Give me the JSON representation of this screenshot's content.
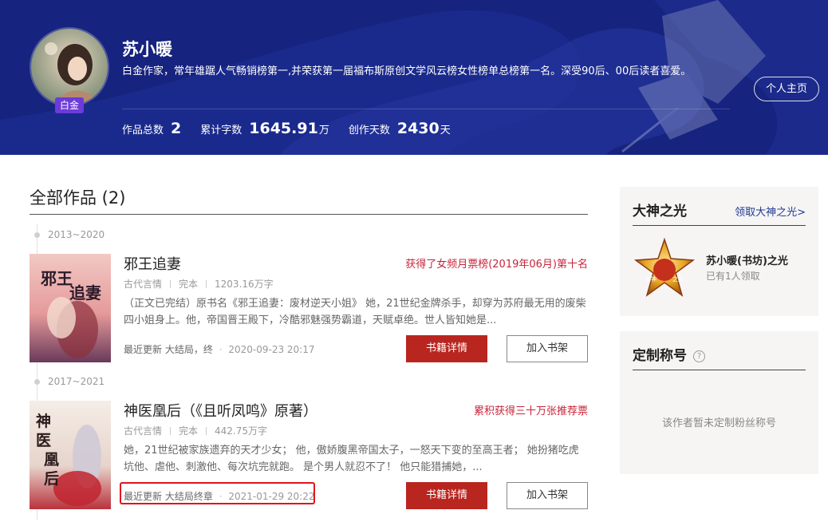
{
  "author": {
    "name": "苏小暖",
    "badge": "白金",
    "intro": "白金作家，常年雄踞人气畅销榜第一,并荣获第一届福布斯原创文学风云榜女性榜单总榜第一名。深受90后、00后读者喜爱。",
    "home_button": "个人主页",
    "stats": {
      "works_label": "作品总数",
      "works_value": "2",
      "words_label": "累计字数",
      "words_value": "1645.91",
      "words_unit": "万",
      "days_label": "创作天数",
      "days_value": "2430",
      "days_unit": "天"
    }
  },
  "works": {
    "title": "全部作品 (2)",
    "books": [
      {
        "year_range": "2013~2020",
        "title": "邪王追妻",
        "honor": "获得了女频月票榜(2019年06月)第十名",
        "category": "古代言情",
        "status": "完本",
        "word_count": "1203.16万字",
        "description": "（正文已完结）原书名《邪王追妻：废材逆天小姐》 她，21世纪金牌杀手，却穿为苏府最无用的废柴四小姐身上。他，帝国晋王殿下，冷酷邪魅强势霸道，天赋卓绝。世人皆知她是...",
        "update_label": "最近更新",
        "update_chapter": "大结局，终",
        "update_time": "2020-09-23 20:17",
        "detail_button": "书籍详情",
        "shelf_button": "加入书架",
        "cover_text": "邪王追妻"
      },
      {
        "year_range": "2017~2021",
        "title": "神医凰后（《且听凤鸣》原著）",
        "honor": "累积获得三十万张推荐票",
        "category": "古代言情",
        "status": "完本",
        "word_count": "442.75万字",
        "description": "她，21世纪被家族遗弃的天才少女； 他，傲娇腹黑帝国太子，一怒天下变的至高王者； 她扮猪吃虎坑他、虐他、刺激他、每次坑完就跑。 是个男人就忍不了！ 他只能猎捕她，...",
        "update_label": "最近更新",
        "update_chapter": "大结局终章",
        "update_time": "2021-01-29 20:22",
        "detail_button": "书籍详情",
        "shelf_button": "加入书架",
        "cover_text": "神医凰后"
      }
    ]
  },
  "sidebar": {
    "glory": {
      "title": "大神之光",
      "link": "领取大神之光>",
      "medal_name": "苏小暖(书坊)之光",
      "medal_sub": "已有1人领取",
      "medal_text_left": "大神",
      "medal_text_right": "之光"
    },
    "custom_title": {
      "title": "定制称号",
      "help": "?",
      "empty": "该作者暂未定制粉丝称号"
    }
  },
  "colors": {
    "banner_bg": "#16237f",
    "badge": "#6c3bd9",
    "honor_red": "#c8243a",
    "button_red": "#b8261f",
    "link_blue": "#1f3a93",
    "highlight_red": "#e0151b"
  }
}
